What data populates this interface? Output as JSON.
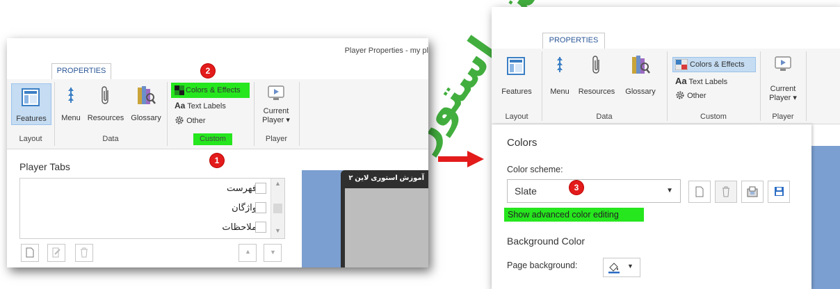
{
  "watermark_text": "آموزش استوری",
  "left_window": {
    "title": "Player Properties - my pl",
    "tab": "PROPERTIES",
    "features_label": "Features",
    "menu_label": "Menu",
    "resources_label": "Resources",
    "glossary_label": "Glossary",
    "colors_effects_label": "Colors & Effects",
    "text_labels_label": "Text Labels",
    "text_labels_prefix": "Aa",
    "other_label": "Other",
    "current_player_label": "Current",
    "current_player_label2": "Player ▾",
    "group_layout": "Layout",
    "group_data": "Data",
    "group_custom": "Custom",
    "group_player": "Player",
    "player_tabs_heading": "Player Tabs",
    "tabs": [
      "فهرست",
      "واژگان",
      "ملاحظات"
    ],
    "preview_title": "آموزش استوری لاین ۲",
    "badge_custom": "1",
    "badge_colors": "2"
  },
  "arrow_color": "#e31b1b",
  "right_window": {
    "tab": "PROPERTIES",
    "features_label": "Features",
    "menu_label": "Menu",
    "resources_label": "Resources",
    "glossary_label": "Glossary",
    "colors_effects_label": "Colors & Effects",
    "text_labels_label": "Text Labels",
    "text_labels_prefix": "Aa",
    "other_label": "Other",
    "current_player_label": "Current",
    "current_player_label2": "Player ▾",
    "group_layout": "Layout",
    "group_data": "Data",
    "group_custom": "Custom",
    "group_player": "Player",
    "colors_heading": "Colors",
    "color_scheme_label": "Color scheme:",
    "color_scheme_value": "Slate",
    "advanced_link": "Show advanced color editing",
    "background_heading": "Background Color",
    "page_background_label": "Page background:",
    "badge_scheme": "3"
  }
}
